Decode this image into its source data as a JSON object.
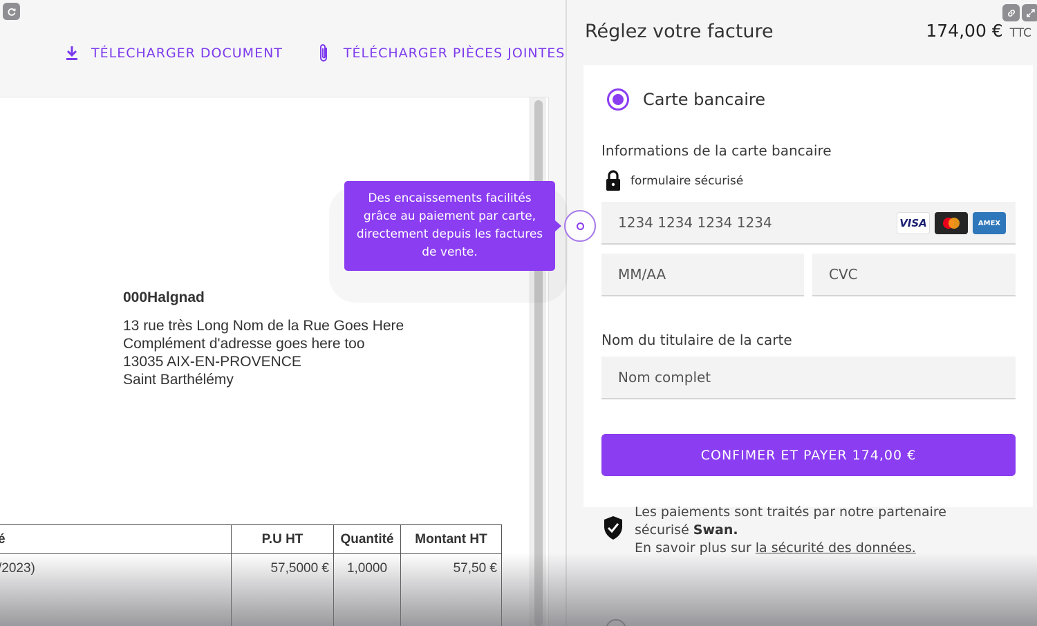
{
  "document_view": {
    "download_document_label": "TÉLECHARGER DOCUMENT",
    "download_attachments_label": "TÉLÉCHARGER PIÈCES JOINTES",
    "client": {
      "name": "000Halgnad",
      "address_lines": [
        "13 rue très Long Nom de la Rue Goes Here",
        "Complément d'adresse goes here too",
        "13035 AIX-EN-PROVENCE",
        "Saint Barthélémy"
      ]
    },
    "table": {
      "headers": [
        "é",
        "P.U HT",
        "Quantité",
        "Montant HT"
      ],
      "rows": [
        [
          "/2023)",
          "57,5000 €",
          "1,0000",
          "57,50 €"
        ]
      ]
    }
  },
  "tooltip": {
    "text": "Des encaissements facilités grâce au paiement par carte, directement depuis les factures de vente."
  },
  "payment": {
    "title": "Réglez votre facture",
    "amount": "174,00 €",
    "amount_suffix": "TTC",
    "method_label": "Carte bancaire",
    "card_info_label": "Informations de la carte bancaire",
    "secure_form_label": "formulaire sécurisé",
    "card_number_placeholder": "1234 1234 1234 1234",
    "brands": [
      "VISA",
      "Mastercard",
      "AMEX"
    ],
    "expiry_placeholder": "MM/AA",
    "cvc_placeholder": "CVC",
    "holder_label": "Nom du titulaire de la carte",
    "holder_placeholder": "Nom complet",
    "pay_button_label": "CONFIMER ET PAYER 174,00 €",
    "note_line1": "Les paiements sont traités par notre partenaire",
    "note_line2_prefix": "sécurisé ",
    "note_partner": "Swan.",
    "note_line3_prefix": "En savoir plus sur ",
    "note_link": "la sécurité des données."
  },
  "colors": {
    "accent": "#8b3df1",
    "link": "#7c3aed"
  }
}
